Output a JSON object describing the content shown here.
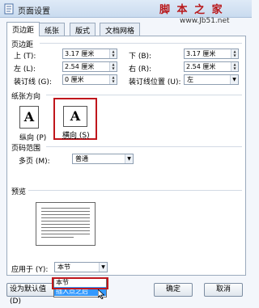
{
  "window": {
    "title": "页面设置",
    "watermark_line1": "脚 本 之 家",
    "watermark_line2": "www.Jb51.net"
  },
  "tabs": [
    {
      "label": "页边距",
      "active": true
    },
    {
      "label": "纸张",
      "active": false
    },
    {
      "label": "版式",
      "active": false
    },
    {
      "label": "文档网格",
      "active": false
    }
  ],
  "margins": {
    "section_label": "页边距",
    "top_label": "上 (T):",
    "top_value": "3.17 厘米",
    "bottom_label": "下 (B):",
    "bottom_value": "3.17 厘米",
    "left_label": "左 (L):",
    "left_value": "2.54 厘米",
    "right_label": "右 (R):",
    "right_value": "2.54 厘米",
    "gutter_label": "装订线 (G):",
    "gutter_value": "0 厘米",
    "gutter_pos_label": "装订线位置 (U):",
    "gutter_pos_value": "左"
  },
  "orientation": {
    "section_label": "纸张方向",
    "portrait_label": "纵向 (P)",
    "landscape_label": "横向 (S)",
    "icon_letter": "A"
  },
  "pages": {
    "section_label": "页码范围",
    "multiple_label": "多页 (M):",
    "multiple_value": "普通"
  },
  "preview": {
    "section_label": "预览"
  },
  "apply": {
    "label": "应用于 (Y):",
    "value": "本节",
    "options": [
      "本节",
      "插入点之后"
    ]
  },
  "buttons": {
    "default": "设为默认值 (D)",
    "ok": "确定",
    "cancel": "取消"
  }
}
